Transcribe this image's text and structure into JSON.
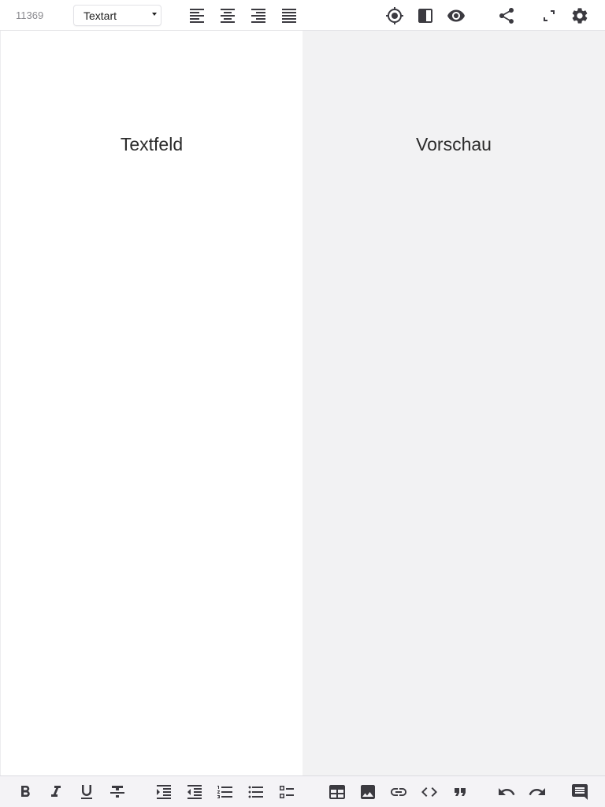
{
  "header": {
    "counter": "11369",
    "text_type": {
      "value": "Textart"
    }
  },
  "icons": {
    "align_left": "format-align-left-icon",
    "align_center": "format-align-center-icon",
    "align_right": "format-align-right-icon",
    "align_justify": "format-align-justify-icon",
    "target": "crosshair-icon",
    "split": "split-view-icon",
    "preview": "eye-icon",
    "share": "share-icon",
    "fullscreen": "fullscreen-icon",
    "settings": "gear-icon"
  },
  "panes": {
    "editor_title": "Textfeld",
    "preview_title": "Vorschau"
  },
  "bottom_toolbar": [
    "bold",
    "italic",
    "underline",
    "strikethrough",
    "indent-increase",
    "indent-decrease",
    "numbered-list",
    "bulleted-list",
    "checklist",
    "table",
    "image",
    "link",
    "code",
    "quote",
    "undo",
    "redo",
    "comment"
  ],
  "colors": {
    "icon": "#3b3a40",
    "toolbar_bg": "#f4f3f6",
    "preview_bg": "#f2f2f3"
  }
}
